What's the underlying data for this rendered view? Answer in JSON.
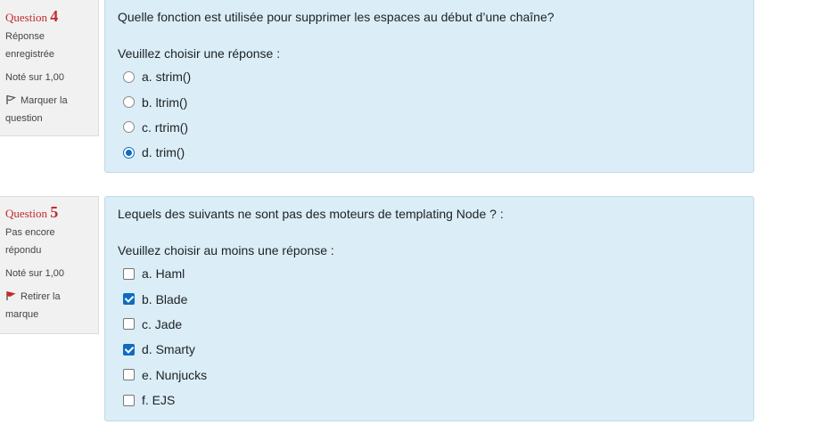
{
  "questions": [
    {
      "label": "Question",
      "number": "4",
      "state": "Réponse enregistrée",
      "grade": "Noté sur 1,00",
      "flag_label": "Marquer la question",
      "flag_icon": "flag-outline-icon",
      "text": "Quelle fonction est utilisée pour supprimer les espaces au début d’une chaîne?",
      "prompt": "Veuillez choisir une réponse :",
      "input_type": "radio",
      "answers": [
        {
          "label": "a. strim()",
          "selected": false
        },
        {
          "label": "b. ltrim()",
          "selected": false
        },
        {
          "label": "c. rtrim()",
          "selected": false
        },
        {
          "label": "d. trim()",
          "selected": true
        }
      ]
    },
    {
      "label": "Question",
      "number": "5",
      "state": "Pas encore répondu",
      "grade": "Noté sur 1,00",
      "flag_label": "Retirer la marque",
      "flag_icon": "flag-filled-red-icon",
      "text": "Lequels des suivants ne sont pas des moteurs de templating Node ? :",
      "prompt": "Veuillez choisir au moins une réponse :",
      "input_type": "checkbox",
      "answers": [
        {
          "label": "a. Haml",
          "selected": false
        },
        {
          "label": "b. Blade",
          "selected": true
        },
        {
          "label": "c. Jade",
          "selected": false
        },
        {
          "label": "d. Smarty",
          "selected": true
        },
        {
          "label": "e. Nunjucks",
          "selected": false
        },
        {
          "label": "f. EJS",
          "selected": false
        }
      ]
    }
  ],
  "colors": {
    "accent": "#0f6cbf",
    "question_number": "#c02c2c",
    "content_bg": "#dbedf6",
    "info_bg": "#f1f1f1"
  }
}
